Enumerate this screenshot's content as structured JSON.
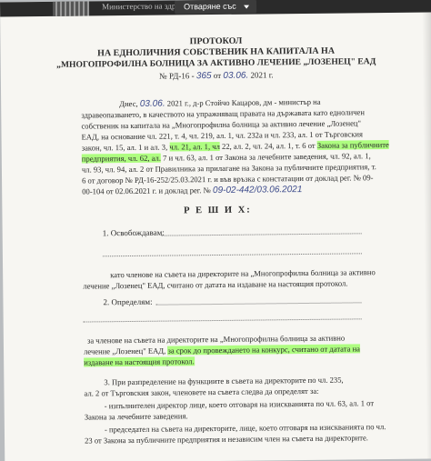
{
  "viewer": {
    "ministry_header": "Министерство на здравеопазването",
    "open_with_label": "Отваряне със"
  },
  "title": {
    "line1": "ПРОТОКОЛ",
    "line2": "НА ЕДНОЛИЧНИЯ СОБСТВЕНИК НА КАПИТАЛА НА",
    "line3": "„МНОГОПРОФИЛНА БОЛНИЦА ЗА АКТИВНО ЛЕЧЕНИЕ „ЛОЗЕНЕЦ\" ЕАД",
    "number_prefix": "№ РД-16 -",
    "number_hand": "365",
    "number_mid": "от",
    "date_hand": "03.06.",
    "number_suffix": "2021 г."
  },
  "body_lines": [
    {
      "a": "Днес,",
      "hand": "03.06.",
      "b": "2021 г., д-р Стойчо Кацаров, дм - министър на"
    },
    {
      "a": "здравеопазването, в качеството на упражняващ правата на държавата като едноличен"
    },
    {
      "a": "собственик на капитала на „Многопрофилна болница за активно лечение „Лозенец\""
    },
    {
      "a": "ЕАД, на основание чл. 221, т. 4, чл. 219, ал. 1, чл. 232а и чл. 233, ал. 1 от Търговския"
    },
    {
      "a": "закон, чл. 15, ал. 1 и ал. 3,",
      "hl": "чл. 21, ал. 1, чл",
      "b": "22, ал. 2, чл. 24, ал. 1, т. 6 от",
      "hl2": "Закона за публичните"
    },
    {
      "hl": "предприятия, чл. 62, ал.",
      "b": "7 и чл. 63, ал. 1 от Закона за лечебните заведения, чл. 92, ал. 1,"
    },
    {
      "a": "чл. 93, чл. 94, ал. 2 от Правилника за прилагане на Закона за публичните предприятия, т."
    },
    {
      "a": "6 от договор № РД-16-252/25.03.2021 г. и във връзка с констатации от доклад рег. № 09-"
    },
    {
      "a": "00-104 от 02.06.2021 г. и доклад рег. №",
      "hand": "09-02-442/03.06.2021"
    }
  ],
  "decision_heading": "Р Е Ш И Х:",
  "item1": {
    "label": "1. Освобождавам:",
    "members_line1": "като членове на съвета на директорите на „Многопрофилна болница за активно",
    "members_line2": "лечение „Лозенец\" ЕАД, считано от датата на издаване на настоящия протокол."
  },
  "item2": {
    "label": "2. Определям:",
    "line1": "за членове на съвета на директорите на „Многопрофилна болница за активно",
    "line2_a": "лечение „Лозенец\" ЕАД,",
    "line2_hl": "за срок до провеждането на конкурс, считано от датата на",
    "line3_hl": "издаване на настоящия протокол."
  },
  "item3": {
    "line1": "3. При разпределение на функциите в съвета на директорите по чл. 235,",
    "line2": "ал. 2 от Търговския закон, членовете на съвета следва да определят за:",
    "line3": "- изпълнителен директор лице, което отговаря на изискванията по чл. 63, ал. 1 от",
    "line4": "Закона за лечебните заведения.",
    "line5": "- председател на съвета на директорите, лице, което отговаря на изискванията по чл.",
    "line6": "23 от Закона за публичните предприятия и независим член на съвета на директорите."
  }
}
